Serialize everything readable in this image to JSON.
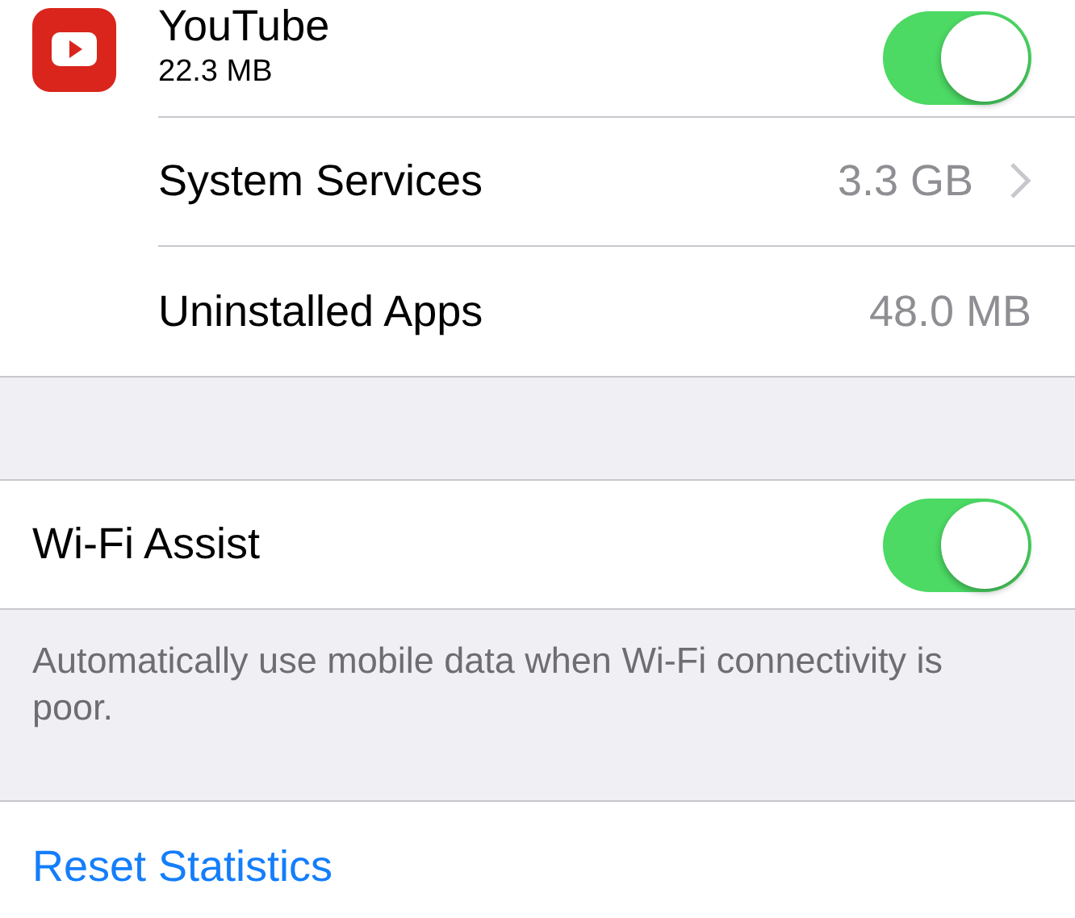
{
  "apps": [
    {
      "name": "YouTube",
      "size": "22.3 MB",
      "on": true
    }
  ],
  "usage_rows": [
    {
      "label": "System Services",
      "value": "3.3 GB",
      "chevron": true
    },
    {
      "label": "Uninstalled Apps",
      "value": "48.0 MB",
      "chevron": false
    }
  ],
  "wifi_assist": {
    "label": "Wi-Fi Assist",
    "on": true,
    "footer": "Automatically use mobile data when Wi-Fi connectivity is poor."
  },
  "reset": {
    "label": "Reset Statistics"
  }
}
